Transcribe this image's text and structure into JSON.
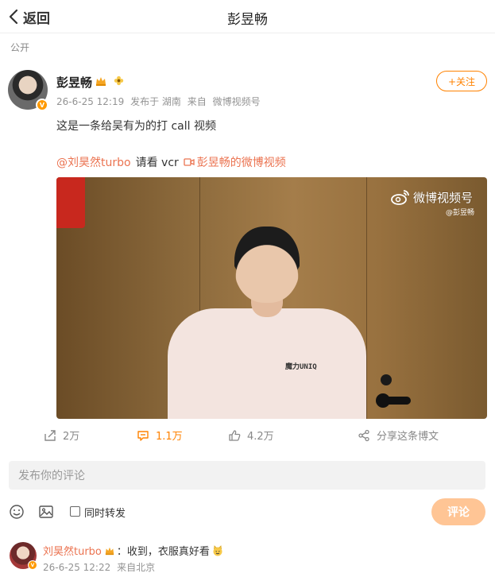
{
  "header": {
    "back_label": "返回",
    "title": "彭昱畅"
  },
  "post": {
    "visibility": "公开",
    "author": "彭昱畅",
    "date": "26-6-25 12:19",
    "location": "发布于 湖南",
    "source_prefix": "来自",
    "source": "微博视频号",
    "follow_label": "+关注",
    "text": "这是一条给吴有为的打 call 视频",
    "mention": "@刘昊然turbo",
    "middle_text": "请看 vcr",
    "video_link": "彭昱畅的微博视频",
    "video": {
      "watermark": "微博视频号",
      "watermark_handle": "@彭昱畅",
      "shirt_text": "魔力UNIQ"
    }
  },
  "actions": {
    "reposts": "2万",
    "comments": "1.1万",
    "likes": "4.2万",
    "share": "分享这条博文"
  },
  "compose": {
    "placeholder": "发布你的评论",
    "repost_label": "同时转发",
    "submit_label": "评论"
  },
  "comment": {
    "author": "刘昊然turbo",
    "text": "：收到，衣服真好看",
    "date": "26-6-25 12:22",
    "source": "来自北京"
  },
  "colors": {
    "accent": "#ff8200",
    "link": "#eb7350",
    "submit_disabled": "#ffc595"
  }
}
